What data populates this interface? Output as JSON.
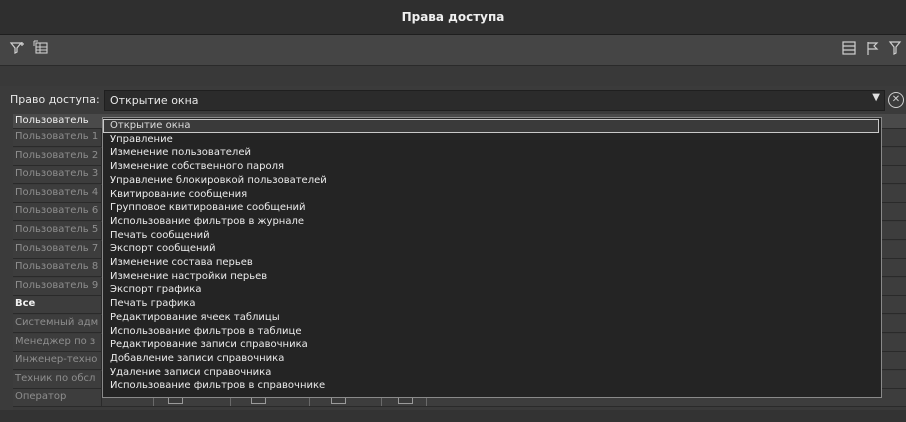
{
  "window": {
    "title": "Права доступа"
  },
  "toolbar": {
    "left_icons": [
      "filter-settings-icon",
      "grid-config-icon"
    ],
    "right_icons": [
      "list-view-icon",
      "flag-icon",
      "filter-icon"
    ]
  },
  "access": {
    "label": "Право доступа:",
    "selected": "Открытие окна",
    "clear_symbol": "⊗",
    "arrow": "▼"
  },
  "grid": {
    "header": "Пользователь",
    "rows": [
      {
        "name": "Пользователь 1",
        "bold": false
      },
      {
        "name": "Пользователь 2",
        "bold": false
      },
      {
        "name": "Пользователь 3",
        "bold": false
      },
      {
        "name": "Пользователь 4",
        "bold": false
      },
      {
        "name": "Пользователь 6",
        "bold": false
      },
      {
        "name": "Пользователь 5",
        "bold": false
      },
      {
        "name": "Пользователь 7",
        "bold": false
      },
      {
        "name": "Пользователь 8",
        "bold": false
      },
      {
        "name": "Пользователь 9",
        "bold": false
      },
      {
        "name": "Все",
        "bold": true
      },
      {
        "name": "Системный адм",
        "bold": false
      },
      {
        "name": "Менеджер по з",
        "bold": false
      },
      {
        "name": "Инженер-техно",
        "bold": false
      },
      {
        "name": "Техник по обсл",
        "bold": false
      },
      {
        "name": "Оператор",
        "bold": false
      }
    ]
  },
  "dropdown": {
    "items": [
      "Открытие окна",
      "Управление",
      "Изменение пользователей",
      "Изменение собственного пароля",
      "Управление блокировкой пользователей",
      "Квитирование сообщения",
      "Групповое квитирование сообщений",
      "Использование фильтров в журнале",
      "Печать сообщений",
      "Экспорт сообщений",
      "Изменение состава перьев",
      "Изменение настройки перьев",
      "Экспорт графика",
      "Печать графика",
      "Редактирование ячеек таблицы",
      "Использование фильтров в таблице",
      "Редактирование записи справочника",
      "Добавление записи справочника",
      "Удаление записи справочника",
      "Использование фильтров в справочнике"
    ]
  }
}
